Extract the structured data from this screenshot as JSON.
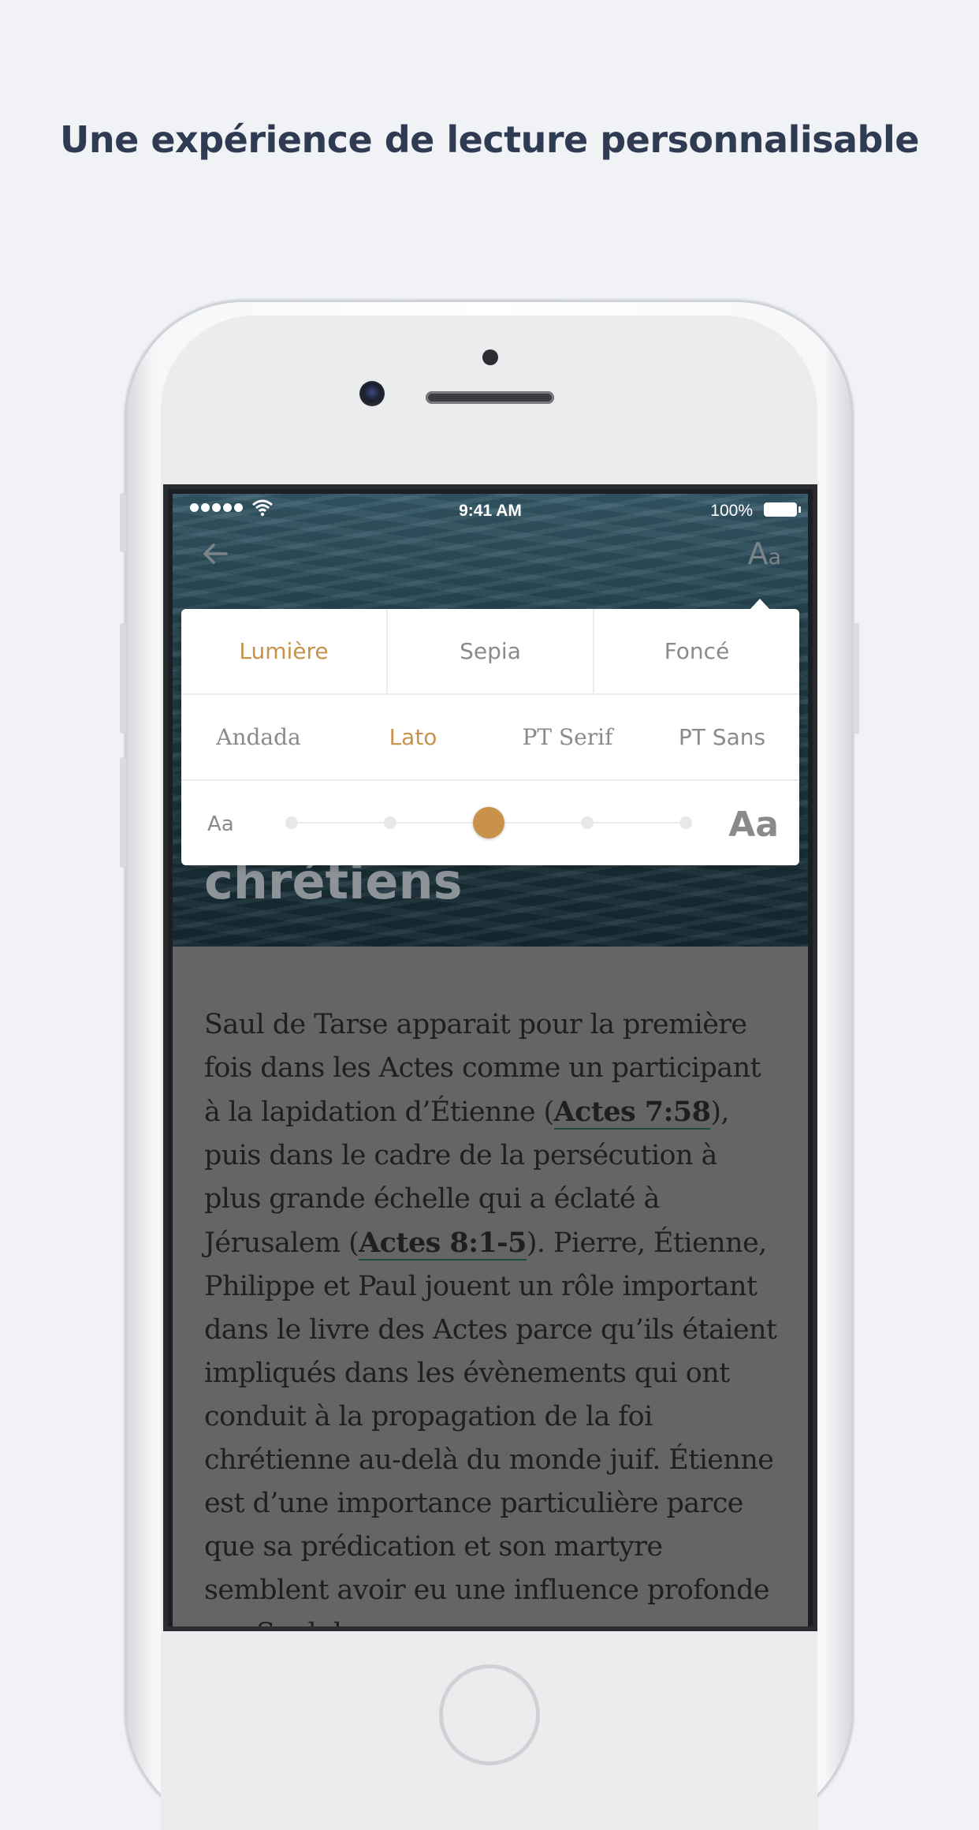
{
  "headline": "Une expérience de lecture personnalisable",
  "status_bar": {
    "time": "9:41 AM",
    "battery": "100%"
  },
  "nav": {
    "font_toggle_big": "A",
    "font_toggle_small": "a"
  },
  "hero": {
    "title": "chrétiens"
  },
  "reading_settings": {
    "themes": [
      "Lumière",
      "Sepia",
      "Foncé"
    ],
    "active_theme": "Lumière",
    "fonts": [
      "Andada",
      "Lato",
      "PT Serif",
      "PT Sans"
    ],
    "active_font": "Lato",
    "size_small_label": "Aa",
    "size_large_label": "Aa",
    "size_steps": 5,
    "size_level": 3
  },
  "article": {
    "t1": "Saul de Tarse apparait pour la première fois dans les Actes comme un participant à la lapidation d’Étienne (",
    "ref1": "Actes 7:58",
    "t2": "), puis dans le cadre de la persécution à plus grande échelle qui a éclaté à Jérusalem (",
    "ref2": "Actes 8:1-5",
    "t3": "). Pierre, Étienne, Philippe et Paul jouent un rôle important dans le livre des Actes parce qu’ils étaient impliqués dans les évènements qui ont conduit à la propagation de la foi chrétienne au-delà du monde juif. Étienne est d’une importance particulière parce que sa prédication et son martyre semblent avoir eu une influence profonde sur Saul de"
  },
  "colors": {
    "accent": "#c8924b",
    "headline": "#2f3b53",
    "overlay": "#656565"
  }
}
